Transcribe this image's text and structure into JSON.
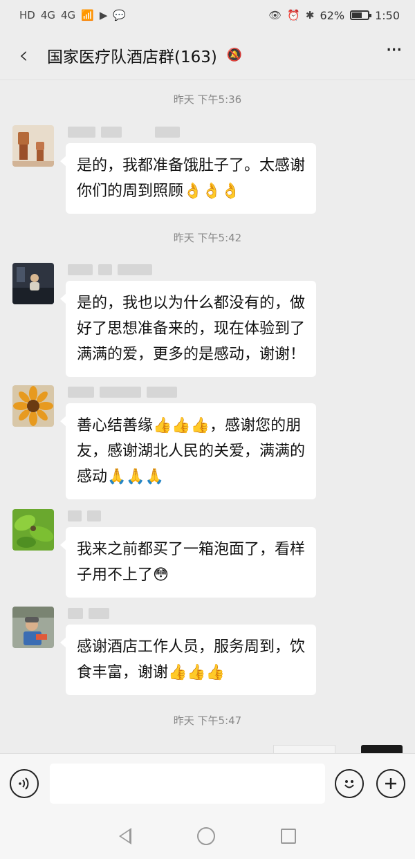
{
  "status_bar": {
    "left_labels": [
      "HD",
      "4G",
      "4G"
    ],
    "battery_percent_label": "62%",
    "battery_level": 0.62,
    "time": "1:50"
  },
  "header": {
    "back_icon": "chevron-left-icon",
    "title": "国家医疗队酒店群(163)",
    "mute_icon": "bell-muted-icon",
    "more_icon": "more-icon"
  },
  "chat": {
    "timestamps": [
      "昨天 下午5:36",
      "昨天 下午5:42",
      "昨天 下午5:47"
    ],
    "messages": [
      {
        "avatar": "avatar-figurines",
        "text_lines": [
          "是的，我都准备饿肚子了。太感谢",
          "你们的周到照顾👌👌👌"
        ]
      },
      {
        "avatar": "avatar-dark-room",
        "text_lines": [
          "是的，我也以为什么都没有的，做",
          "好了思想准备来的，现在体验到了",
          "满满的爱，更多的是感动，谢谢！"
        ]
      },
      {
        "avatar": "avatar-sunflower",
        "text_lines": [
          "善心结善缘👍👍👍，感谢您的朋",
          "友，感谢湖北人民的关爱，满满的",
          "感动🙏🙏🙏"
        ]
      },
      {
        "avatar": "avatar-leaves",
        "text_lines": [
          "我来之前都买了一箱泡面了，看样",
          "子用不上了😳"
        ]
      },
      {
        "avatar": "avatar-child",
        "text_lines": [
          "感谢酒店工作人员，服务周到，饮",
          "食丰富，谢谢👍👍👍"
        ]
      }
    ]
  },
  "input_bar": {
    "voice_icon": "voice-icon",
    "emoji_icon": "emoji-icon",
    "plus_icon": "plus-icon"
  },
  "colors": {
    "background": "#ededed",
    "bubble": "#ffffff",
    "text": "#111111",
    "timestamp": "#888888"
  }
}
